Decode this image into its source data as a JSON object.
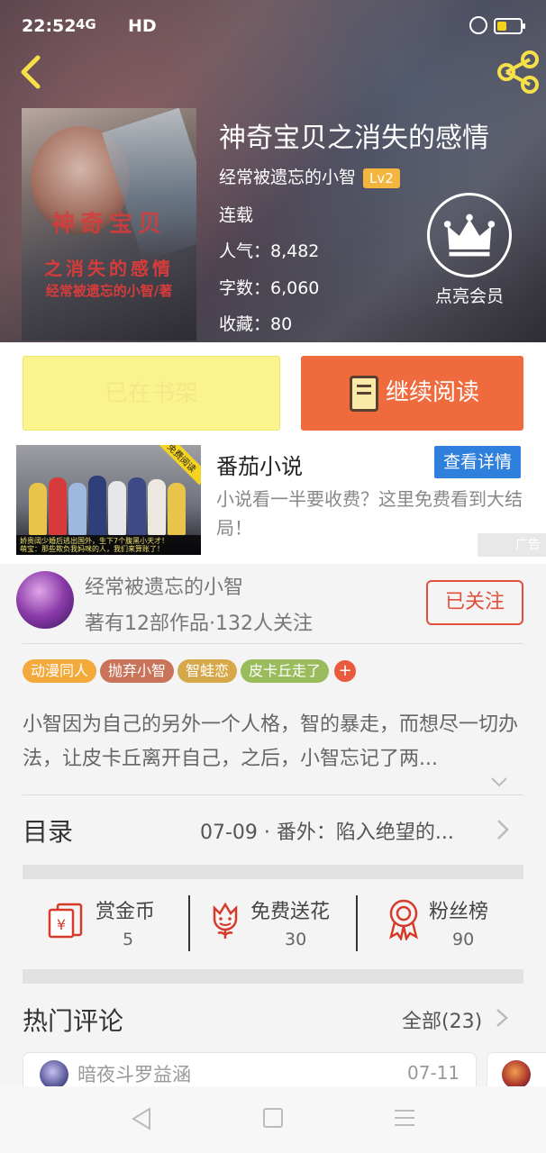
{
  "status": {
    "time": "22:52",
    "network": "4G",
    "hd": "HD"
  },
  "book": {
    "title": "神奇宝贝之消失的感情",
    "author": "经常被遗忘的小智",
    "level": "Lv2",
    "status": "连载",
    "popularity": "人气：8,482",
    "words": "字数：6,060",
    "favorites": "收藏：80",
    "vip_label": "点亮会员",
    "cover_text": {
      "line1": "神奇宝贝",
      "line2": "之消失的感情",
      "line3": "经常被遗忘的小智/著"
    }
  },
  "buttons": {
    "shelf": "已在书架",
    "continue": "继续阅读"
  },
  "ad": {
    "badge": "免费阅读",
    "caption1": "娇贵阔少婚后逃出国外，生下7个腹黑小天才！",
    "caption2": "萌宝：那些欺负我妈咪的人，我们来算账了！",
    "title": "番茄小说",
    "detail_button": "查看详情",
    "description": "小说看一半要收费？这里免费看到大结局！",
    "tag": "广告"
  },
  "author_card": {
    "name": "经常被遗忘的小智",
    "stats": "著有12部作品·132人关注",
    "follow_label": "已关注"
  },
  "tags": [
    {
      "label": "动漫同人",
      "color": "#f4a93b"
    },
    {
      "label": "抛弃小智",
      "color": "#c9735a"
    },
    {
      "label": "智蛙恋",
      "color": "#d6a84a"
    },
    {
      "label": "皮卡丘走了",
      "color": "#9bbc5c"
    }
  ],
  "tag_add": "+",
  "description": "小智因为自己的另外一个人格，智的暴走，而想尽一切办法，让皮卡丘离开自己，之后，小智忘记了两...",
  "toc": {
    "label": "目录",
    "latest": "07-09 · 番外：陷入绝望的..."
  },
  "actions": [
    {
      "label": "赏金币",
      "value": "5"
    },
    {
      "label": "免费送花",
      "value": "30"
    },
    {
      "label": "粉丝榜",
      "value": "90"
    }
  ],
  "comments": {
    "title": "热门评论",
    "all_label": "全部(23)",
    "first": {
      "user": "暗夜斗罗益涵",
      "date": "07-11"
    }
  },
  "colors": {
    "accent": "#ef6b3e",
    "follow": "#e0503c",
    "shelf": "#fbf38c",
    "ad_blue": "#2f7fdc"
  }
}
